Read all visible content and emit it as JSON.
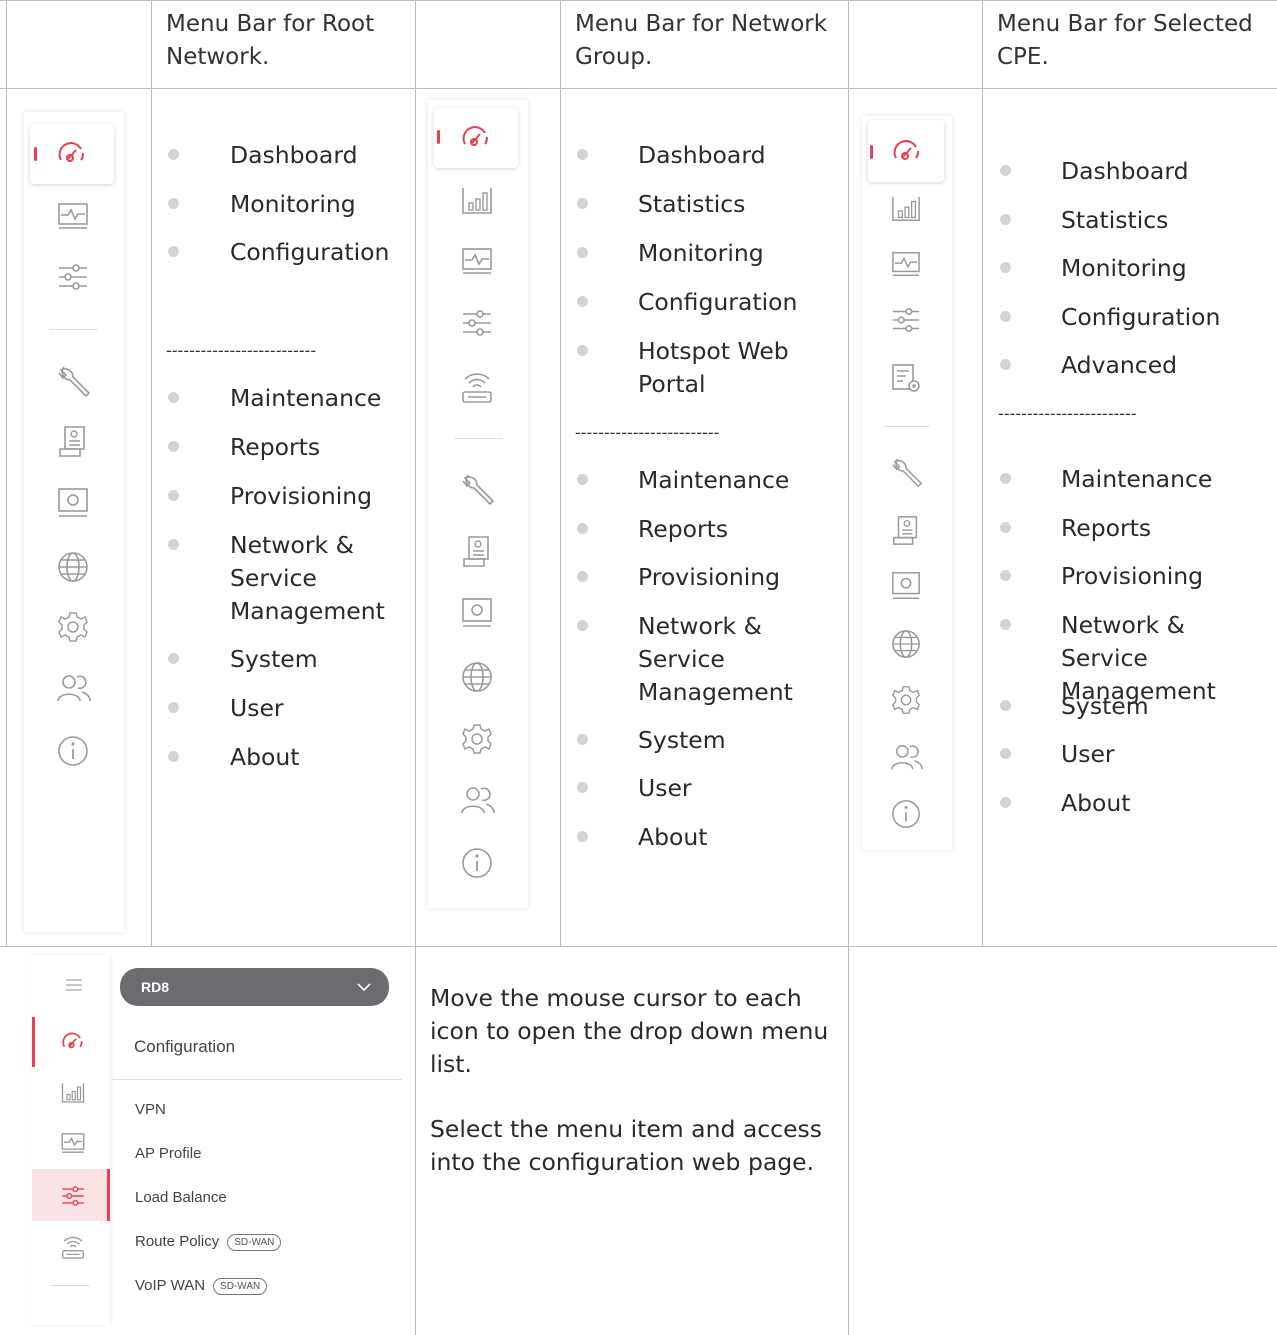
{
  "headers": {
    "root": "Menu Bar for Root Network.",
    "group": "Menu Bar for Network Group.",
    "cpe": "Menu Bar for Selected CPE."
  },
  "root_menu": {
    "primary": [
      "Dashboard",
      "Monitoring",
      "Configuration"
    ],
    "separator": "--------------------------",
    "secondary": [
      "Maintenance",
      "Reports",
      "Provisioning",
      "Network & Service Management",
      "System",
      "User",
      "About"
    ],
    "icons": [
      "dashboard-icon",
      "monitoring-icon",
      "configuration-icon",
      "maintenance-icon",
      "reports-icon",
      "provisioning-icon",
      "network-globe-icon",
      "system-gear-icon",
      "user-icon",
      "about-info-icon"
    ]
  },
  "group_menu": {
    "primary": [
      "Dashboard",
      "Statistics",
      "Monitoring",
      "Configuration",
      "Hotspot Web Portal"
    ],
    "separator": "-------------------------",
    "secondary": [
      "Maintenance",
      "Reports",
      "Provisioning",
      "Network & Service Management",
      "System",
      "User",
      "About"
    ],
    "icons": [
      "dashboard-icon",
      "statistics-icon",
      "monitoring-icon",
      "configuration-icon",
      "hotspot-router-icon",
      "maintenance-icon",
      "reports-icon",
      "provisioning-icon",
      "network-globe-icon",
      "system-gear-icon",
      "user-icon",
      "about-info-icon"
    ]
  },
  "cpe_menu": {
    "primary": [
      "Dashboard",
      "Statistics",
      "Monitoring",
      "Configuration",
      "Advanced"
    ],
    "separator": "------------------------",
    "secondary": [
      "Maintenance",
      "Reports",
      "Provisioning",
      "Network & Service Management",
      "System",
      "User",
      "About"
    ],
    "icons": [
      "dashboard-icon",
      "statistics-icon",
      "monitoring-icon",
      "configuration-icon",
      "advanced-settings-icon",
      "maintenance-icon",
      "reports-icon",
      "provisioning-icon",
      "network-globe-icon",
      "system-gear-icon",
      "user-icon",
      "about-info-icon"
    ]
  },
  "screenshot": {
    "device": "RD8",
    "menu_title": "Configuration",
    "items": [
      {
        "label": "VPN",
        "tag": ""
      },
      {
        "label": "AP Profile",
        "tag": ""
      },
      {
        "label": "Load Balance",
        "tag": ""
      },
      {
        "label": "Route Policy",
        "tag": "SD-WAN"
      },
      {
        "label": "VoIP WAN",
        "tag": "SD-WAN"
      }
    ]
  },
  "instructions": {
    "p1": "Move the mouse cursor to each icon to open the drop down menu list.",
    "p2": "Select the menu item and access into the configuration web page."
  },
  "colors": {
    "accent": "#e8404f",
    "icon": "#9a9a9a",
    "pill": "#6c6c70"
  }
}
